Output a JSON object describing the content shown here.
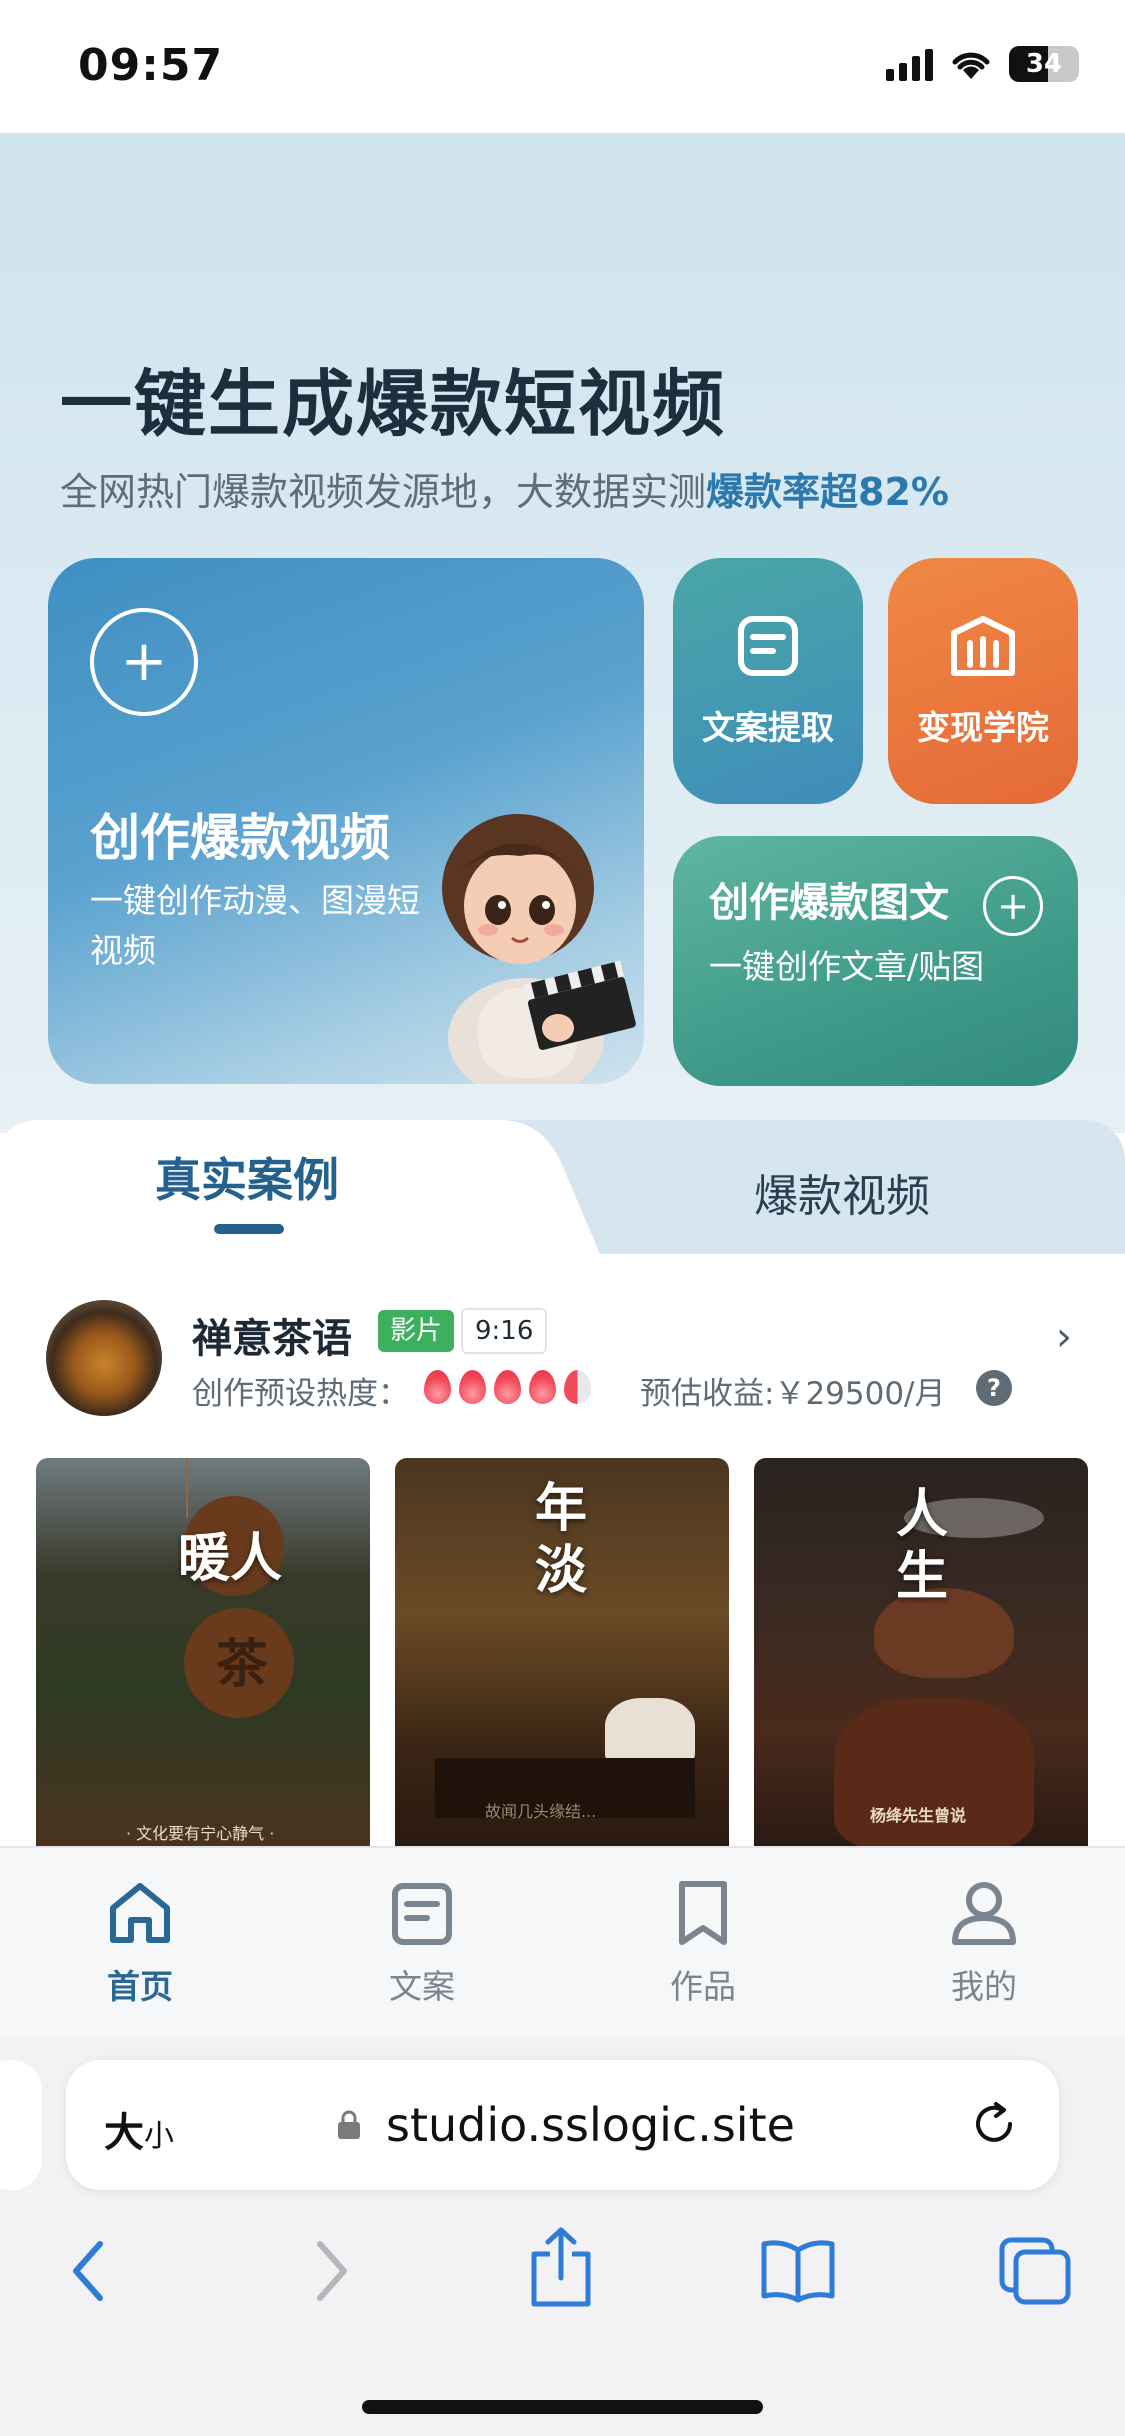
{
  "status_bar": {
    "time": "09:57",
    "battery": "34"
  },
  "hero": {
    "title": "一键生成爆款短视频",
    "subtitle_prefix": "全网热门爆款视频发源地，大数据实测",
    "subtitle_highlight": "爆款率超82%"
  },
  "cards": {
    "create_video_title": "创作爆款视频",
    "create_video_desc": "一键创作动漫、图漫短视频",
    "copy_extract_label": "文案提取",
    "academy_label": "变现学院",
    "create_post_title": "创作爆款图文",
    "create_post_desc": "一键创作文章/贴图"
  },
  "tabs": {
    "active": "真实案例",
    "inactive": "爆款视频"
  },
  "case": {
    "name": "禅意茶语",
    "badge_type": "影片",
    "badge_ratio": "9:16",
    "heat_label": "创作预设热度：",
    "heat_level": 4.5,
    "income": "预估收益:￥29500/月",
    "thumbs": [
      {
        "text": "暖人",
        "text2": "茶",
        "caption": "· 文化要有宁心静气 ·"
      },
      {
        "text": "年淡",
        "caption": "故闻几头缘结..."
      },
      {
        "text": "人生",
        "caption": "杨绛先生曾说"
      }
    ]
  },
  "tabbar": {
    "items": [
      {
        "label": "首页",
        "icon": "home-icon",
        "active": true
      },
      {
        "label": "文案",
        "icon": "document-icon",
        "active": false
      },
      {
        "label": "作品",
        "icon": "bookmark-icon",
        "active": false
      },
      {
        "label": "我的",
        "icon": "user-icon",
        "active": false
      }
    ]
  },
  "safari": {
    "size_label": "大",
    "size_small": "小",
    "url": "studio.sslogic.site"
  },
  "colors": {
    "accent": "#2a6894",
    "orange": "#e56a36",
    "green": "#3f9a8a",
    "badge_green": "#3db05e"
  }
}
